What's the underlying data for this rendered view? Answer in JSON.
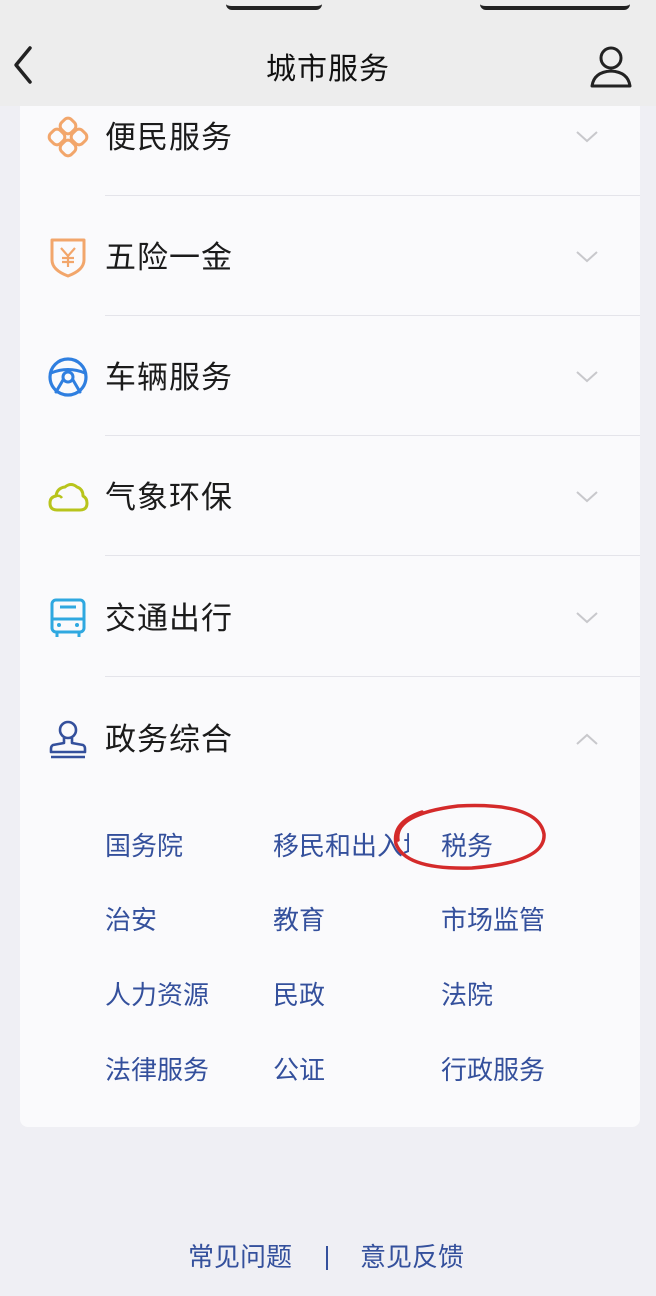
{
  "header": {
    "title": "城市服务",
    "back_icon": "chevron-left-icon",
    "user_icon": "user-icon"
  },
  "categories": [
    {
      "label": "便民服务",
      "icon": "knot-icon",
      "color": "#f2a66b",
      "expanded": false
    },
    {
      "label": "五险一金",
      "icon": "shield-yuan-icon",
      "color": "#f2a66b",
      "expanded": false
    },
    {
      "label": "车辆服务",
      "icon": "steering-wheel-icon",
      "color": "#2f7fe0",
      "expanded": false
    },
    {
      "label": "气象环保",
      "icon": "cloud-icon",
      "color": "#b8c41c",
      "expanded": false
    },
    {
      "label": "交通出行",
      "icon": "bus-icon",
      "color": "#2fa8e0",
      "expanded": false
    },
    {
      "label": "政务综合",
      "icon": "stamp-icon",
      "color": "#34509c",
      "expanded": true
    }
  ],
  "sub_items": [
    [
      "国务院",
      "移民和出入境",
      "税务"
    ],
    [
      "治安",
      "教育",
      "市场监管"
    ],
    [
      "人力资源",
      "民政",
      "法院"
    ],
    [
      "法律服务",
      "公证",
      "行政服务"
    ]
  ],
  "footer": {
    "faq": "常见问题",
    "feedback": "意见反馈"
  },
  "colors": {
    "link": "#34509c",
    "highlight_circle": "#d42a2a"
  }
}
